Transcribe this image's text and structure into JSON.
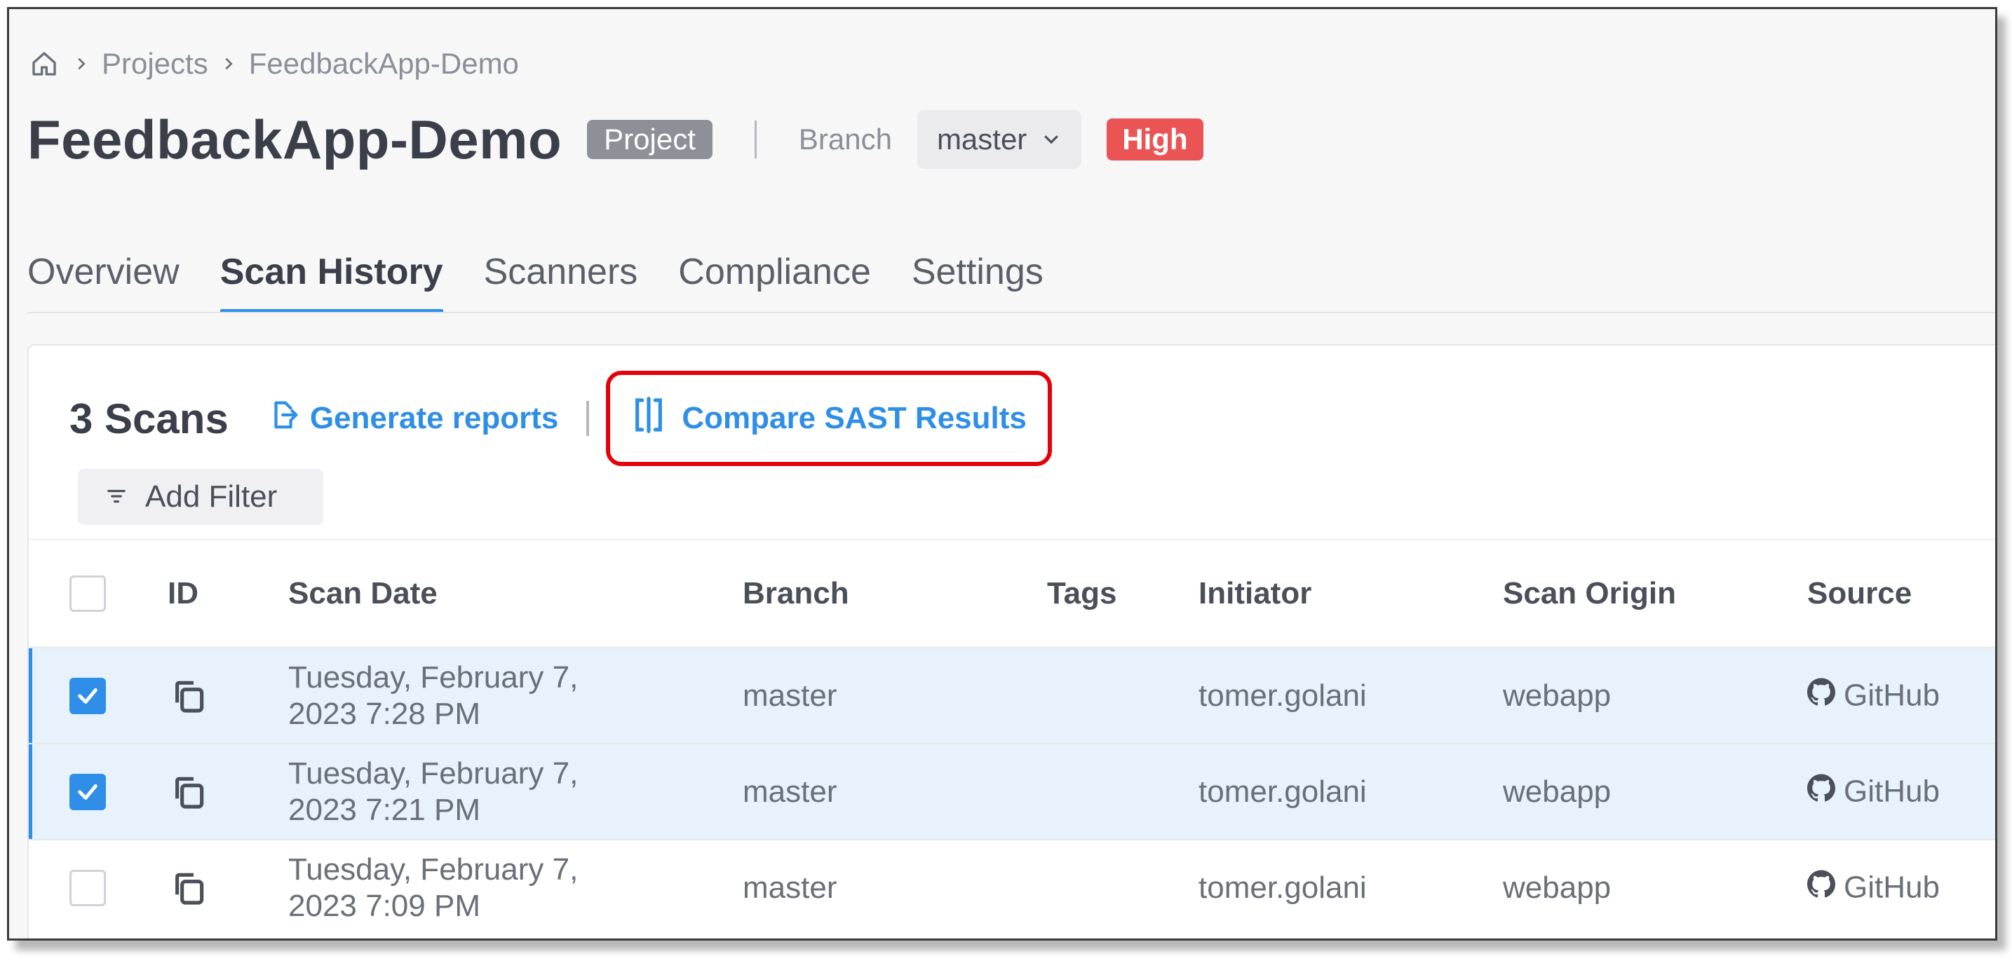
{
  "breadcrumb": {
    "items": [
      "Projects",
      "FeedbackApp-Demo"
    ]
  },
  "project": {
    "title": "FeedbackApp-Demo",
    "type_badge": "Project",
    "branch_label": "Branch",
    "branch_value": "master",
    "risk_badge": "High"
  },
  "tabs": [
    {
      "label": "Overview",
      "active": false
    },
    {
      "label": "Scan History",
      "active": true
    },
    {
      "label": "Scanners",
      "active": false
    },
    {
      "label": "Compliance",
      "active": false
    },
    {
      "label": "Settings",
      "active": false
    }
  ],
  "scans": {
    "count_label": "3 Scans",
    "generate_reports": "Generate reports",
    "compare_sast": "Compare SAST Results",
    "add_filter": "Add Filter"
  },
  "table": {
    "columns": {
      "id": "ID",
      "scan_date": "Scan Date",
      "branch": "Branch",
      "tags": "Tags",
      "initiator": "Initiator",
      "scan_origin": "Scan Origin",
      "source": "Source"
    },
    "rows": [
      {
        "checked": true,
        "date_line1": "Tuesday, February 7,",
        "date_line2": "2023 7:28 PM",
        "branch": "master",
        "tags": "",
        "initiator": "tomer.golani",
        "origin": "webapp",
        "source": "GitHub"
      },
      {
        "checked": true,
        "date_line1": "Tuesday, February 7,",
        "date_line2": "2023 7:21 PM",
        "branch": "master",
        "tags": "",
        "initiator": "tomer.golani",
        "origin": "webapp",
        "source": "GitHub"
      },
      {
        "checked": false,
        "date_line1": "Tuesday, February 7,",
        "date_line2": "2023 7:09 PM",
        "branch": "master",
        "tags": "",
        "initiator": "tomer.golani",
        "origin": "webapp",
        "source": "GitHub"
      }
    ]
  },
  "colors": {
    "accent": "#2f8ee8",
    "high_risk": "#ea5455",
    "highlight_box": "#e6000a",
    "selected_row": "#e8f2fc"
  },
  "icons": {
    "home": "home-icon",
    "chevron": "chevron-right-icon",
    "dropdown": "chevron-down-icon",
    "generate": "export-report-icon",
    "compare": "compare-icon",
    "filter": "filter-icon",
    "copy": "copy-icon",
    "github": "github-icon",
    "check": "check-icon"
  }
}
